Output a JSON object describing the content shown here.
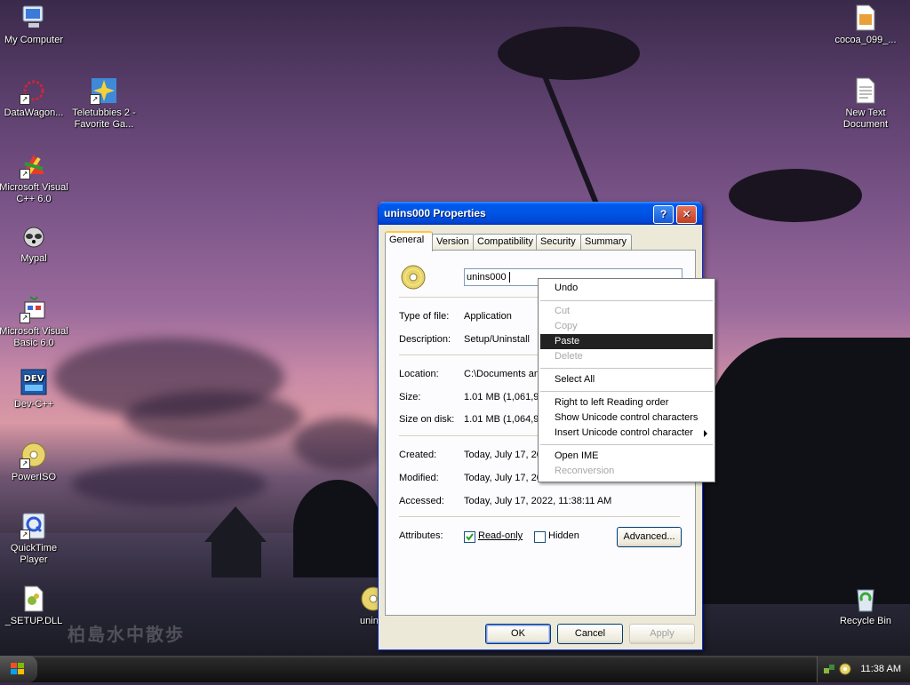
{
  "desktop": {
    "icons": [
      {
        "label": "My Computer"
      },
      {
        "label": "DataWagon..."
      },
      {
        "label": "Teletubbies 2 - Favorite Ga..."
      },
      {
        "label": "Microsoft Visual C++ 6.0"
      },
      {
        "label": "Mypal"
      },
      {
        "label": "Microsoft Visual Basic 6.0"
      },
      {
        "label": "Dev-C++"
      },
      {
        "label": "PowerISO"
      },
      {
        "label": "QuickTime Player"
      },
      {
        "label": "_SETUP.DLL"
      },
      {
        "label": "unin..."
      },
      {
        "label": "cocoa_099_..."
      },
      {
        "label": "New Text Document"
      },
      {
        "label": "Recycle Bin"
      }
    ],
    "watermark": "柏島水中散歩"
  },
  "window": {
    "title": "unins000 Properties",
    "help_glyph": "?",
    "close_glyph": "✕",
    "tabs": [
      {
        "label": "General"
      },
      {
        "label": "Version"
      },
      {
        "label": "Compatibility"
      },
      {
        "label": "Security"
      },
      {
        "label": "Summary"
      }
    ],
    "name_value": "unins000",
    "fields": {
      "type_label": "Type of file:",
      "type_value": "Application",
      "desc_label": "Description:",
      "desc_value": "Setup/Uninstall",
      "location_label": "Location:",
      "location_value": "C:\\Documents an",
      "size_label": "Size:",
      "size_value": "1.01 MB (1,061,9",
      "sizeondisk_label": "Size on disk:",
      "sizeondisk_value": "1.01 MB (1,064,9",
      "created_label": "Created:",
      "created_value": "Today, July 17, 20",
      "modified_label": "Modified:",
      "modified_value": "Today, July 17, 20",
      "accessed_label": "Accessed:",
      "accessed_value": "Today, July 17, 2022, 11:38:11 AM"
    },
    "attributes_label": "Attributes:",
    "readonly_label": "Read-only",
    "hidden_label": "Hidden",
    "advanced_label": "Advanced...",
    "ok_label": "OK",
    "cancel_label": "Cancel",
    "apply_label": "Apply"
  },
  "context_menu": {
    "items": [
      {
        "label": "Undo"
      },
      {
        "label": "Cut"
      },
      {
        "label": "Copy"
      },
      {
        "label": "Paste"
      },
      {
        "label": "Delete"
      },
      {
        "label": "Select All"
      },
      {
        "label": "Right to left Reading order"
      },
      {
        "label": "Show Unicode control characters"
      },
      {
        "label": "Insert Unicode control character"
      },
      {
        "label": "Open IME"
      },
      {
        "label": "Reconversion"
      }
    ]
  },
  "taskbar": {
    "clock": "11:38 AM"
  }
}
